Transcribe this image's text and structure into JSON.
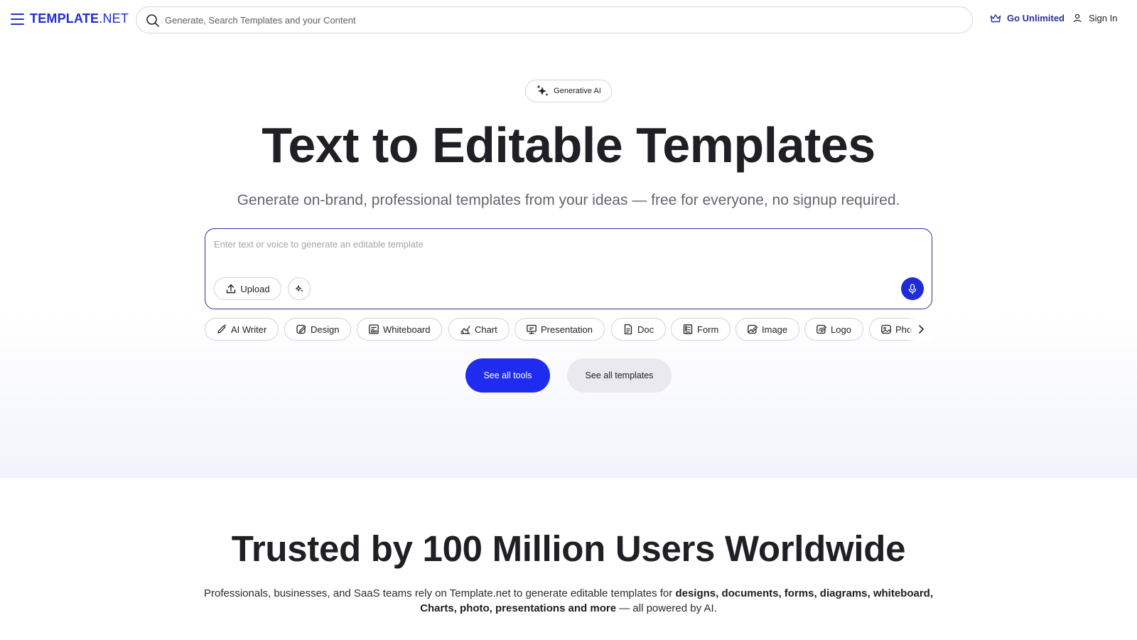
{
  "header": {
    "logo_bold": "TEMPLATE",
    "logo_light": ".NET",
    "search_placeholder": "Generate, Search Templates and your Content",
    "go_unlimited": "Go Unlimited",
    "sign_in": "Sign In"
  },
  "hero": {
    "badge": "Generative AI",
    "title": "Text to Editable Templates",
    "subtitle": "Generate on-brand, professional templates from your ideas — free for everyone, no signup required.",
    "prompt_placeholder": "Enter text or voice to generate an editable template",
    "upload_label": "Upload",
    "chips": [
      {
        "label": "AI Writer",
        "icon": "pen-sparkle-icon"
      },
      {
        "label": "Design",
        "icon": "design-icon"
      },
      {
        "label": "Whiteboard",
        "icon": "whiteboard-icon"
      },
      {
        "label": "Chart",
        "icon": "chart-icon"
      },
      {
        "label": "Presentation",
        "icon": "presentation-icon"
      },
      {
        "label": "Doc",
        "icon": "doc-icon"
      },
      {
        "label": "Form",
        "icon": "form-icon"
      },
      {
        "label": "Image",
        "icon": "image-icon"
      },
      {
        "label": "Logo",
        "icon": "logo-icon"
      },
      {
        "label": "Pho",
        "icon": "photo-icon"
      }
    ],
    "see_all_tools": "See all tools",
    "see_all_templates": "See all templates"
  },
  "trusted": {
    "title": "Trusted by 100 Million Users Worldwide",
    "desc_prefix": "Professionals, businesses, and SaaS teams rely on Template.net to generate editable templates for ",
    "desc_bold": "designs, documents, forms, diagrams, whiteboard, Charts, photo, presentations and more",
    "desc_suffix": " — all powered by AI."
  },
  "colors": {
    "brand_blue": "#1f2bd6",
    "primary_button": "#1f2bee",
    "navy_accent": "#2a2f9c"
  }
}
